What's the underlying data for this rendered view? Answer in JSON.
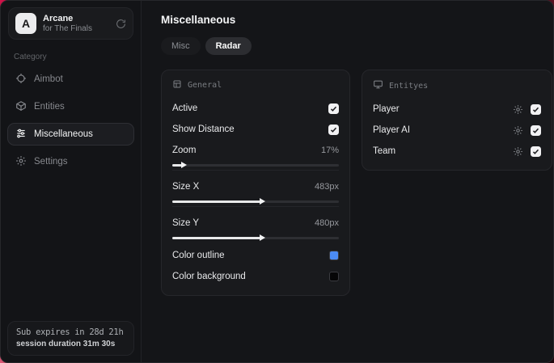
{
  "app": {
    "name": "Arcane",
    "subtitle": "for The Finals",
    "logo_letter": "A"
  },
  "sidebar": {
    "category_label": "Category",
    "items": [
      {
        "label": "Aimbot",
        "active": false
      },
      {
        "label": "Entities",
        "active": false
      },
      {
        "label": "Miscellaneous",
        "active": true
      },
      {
        "label": "Settings",
        "active": false
      }
    ],
    "status": {
      "sub_expires": "Sub expires in 28d 21h",
      "session_duration": "session duration 31m 30s"
    }
  },
  "header": {
    "title": "Miscellaneous"
  },
  "tabs": [
    {
      "label": "Misc",
      "active": false
    },
    {
      "label": "Radar",
      "active": true
    }
  ],
  "panels": {
    "general": {
      "title": "General",
      "toggles": [
        {
          "label": "Active",
          "checked": true
        },
        {
          "label": "Show Distance",
          "checked": true
        }
      ],
      "sliders": [
        {
          "label": "Zoom",
          "value": "17%",
          "percent": 6
        },
        {
          "label": "Size X",
          "value": "483px",
          "percent": 53
        },
        {
          "label": "Size Y",
          "value": "480px",
          "percent": 53
        }
      ],
      "colors": [
        {
          "label": "Color outline",
          "hex": "#4b8bf5"
        },
        {
          "label": "Color background",
          "hex": "#060607"
        }
      ]
    },
    "entities": {
      "title": "Entityes",
      "items": [
        {
          "label": "Player",
          "checked": true
        },
        {
          "label": "Player AI",
          "checked": true
        },
        {
          "label": "Team",
          "checked": true
        }
      ]
    }
  },
  "colors": {
    "accent_blue": "#4b8bf5",
    "backdrop_red": "#d3134a"
  }
}
